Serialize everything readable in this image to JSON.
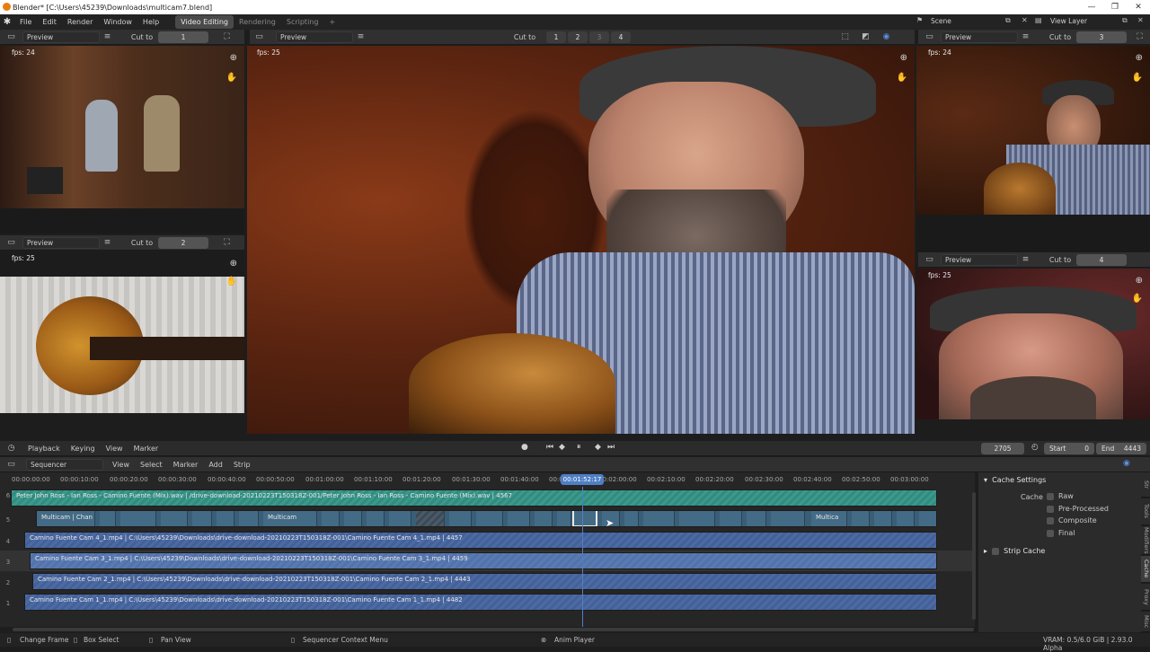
{
  "window": {
    "title": "Blender* [C:\\Users\\45239\\Downloads\\multicam7.blend]",
    "minimize": "—",
    "maximize": "❐",
    "close": "✕"
  },
  "menubar": {
    "items": [
      "File",
      "Edit",
      "Render",
      "Window",
      "Help"
    ],
    "workspaces": [
      "Video Editing",
      "Rendering",
      "Scripting"
    ],
    "add_tab": "+",
    "scene": "Scene",
    "view_layer": "View Layer"
  },
  "previews": {
    "top_left": {
      "mode": "Preview",
      "cut_label": "Cut to",
      "cut_value": "1",
      "fps": "fps: 24"
    },
    "bottom_left": {
      "mode": "Preview",
      "cut_label": "Cut to",
      "cut_value": "2",
      "fps": "fps: 25"
    },
    "main": {
      "mode": "Preview",
      "cut_label": "Cut to",
      "cut_buttons": [
        "1",
        "2",
        "3",
        "4"
      ],
      "fps": "fps: 25"
    },
    "top_right": {
      "mode": "Preview",
      "cut_label": "Cut to",
      "cut_value": "3",
      "fps": "fps: 24"
    },
    "bottom_right": {
      "mode": "Preview",
      "cut_label": "Cut to",
      "cut_value": "4",
      "fps": "fps: 25"
    }
  },
  "timeline": {
    "menus": [
      "Playback",
      "Keying",
      "View",
      "Marker"
    ],
    "current_frame": "2705",
    "start_label": "Start",
    "start": "0",
    "end_label": "End",
    "end": "4443"
  },
  "sequencer": {
    "editor": "Sequencer",
    "menus": [
      "View",
      "Select",
      "Marker",
      "Add",
      "Strip"
    ],
    "ruler": [
      "00:00:00:00",
      "00:00:10:00",
      "00:00:20:00",
      "00:00:30:00",
      "00:00:40:00",
      "00:00:50:00",
      "00:01:00:00",
      "00:01:10:00",
      "00:01:20:00",
      "00:01:30:00",
      "00:01:40:00",
      "00:01:50:00",
      "00:02:00:00",
      "00:02:10:00",
      "00:02:20:00",
      "00:02:30:00",
      "00:02:40:00",
      "00:02:50:00",
      "00:03:00:00"
    ],
    "playhead": "00:01:52:17",
    "channels": [
      "6",
      "5",
      "4",
      "3",
      "2",
      "1"
    ],
    "strips": {
      "sound": "Peter John Ross - Ian Ross - Camino Fuente (Mix).wav | /drive-download-20210223T150318Z-001/Peter John Ross - Ian Ross - Camino Fuente (Mix).wav | 4567",
      "multicam_labels": [
        "Multicam | Chan",
        "Multicam",
        "Multica"
      ],
      "cam4": "Camino Fuente Cam 4_1.mp4 | C:\\Users\\45239\\Downloads\\drive-download-20210223T150318Z-001\\Camino Fuente Cam 4_1.mp4 | 4457",
      "cam3": "Camino Fuente Cam 3_1.mp4 | C:\\Users\\45239\\Downloads\\drive-download-20210223T150318Z-001\\Camino Fuente Cam 3_1.mp4 | 4459",
      "cam2": "Camino Fuente Cam 2_1.mp4 | C:\\Users\\45239\\Downloads\\drive-download-20210223T150318Z-001\\Camino Fuente Cam 2_1.mp4 | 4443",
      "cam1": "Camino Fuente Cam 1_1.mp4 | C:\\Users\\45239\\Downloads\\drive-download-20210223T150318Z-001\\Camino Fuente Cam 1_1.mp4 | 4482"
    }
  },
  "sidebar": {
    "cache_settings": "Cache Settings",
    "cache_label": "Cache",
    "options": [
      "Raw",
      "Pre-Processed",
      "Composite",
      "Final"
    ],
    "strip_cache": "Strip Cache",
    "tabs": [
      "Str",
      "Tools",
      "Modifiers",
      "Cache",
      "Proxy",
      "Misc"
    ]
  },
  "statusbar": {
    "change_frame": "Change Frame",
    "box_select": "Box Select",
    "pan_view": "Pan View",
    "context_menu": "Sequencer Context Menu",
    "anim_player": "Anim Player",
    "vram": "VRAM: 0.5/6.0 GiB | 2.93.0 Alpha"
  },
  "colors": {
    "movie_strip": "#4c6ba2",
    "sound_strip": "#3a9a8c",
    "multicam_strip": "#3a5e78",
    "playhead": "#4f7fc4"
  }
}
